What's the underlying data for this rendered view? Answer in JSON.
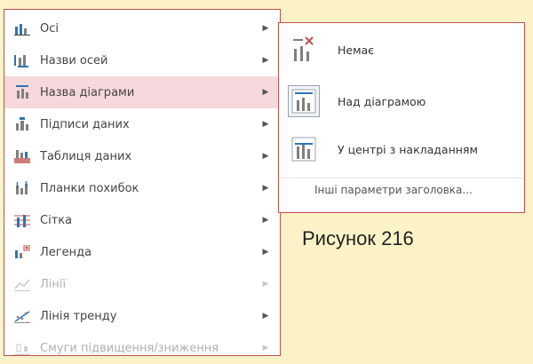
{
  "main_menu": {
    "items": [
      {
        "label": "Осі",
        "icon": "axes-icon",
        "disabled": false,
        "highlighted": false
      },
      {
        "label": "Назви осей",
        "icon": "axis-titles-icon",
        "disabled": false,
        "highlighted": false
      },
      {
        "label": "Назва діаграми",
        "icon": "chart-title-icon",
        "disabled": false,
        "highlighted": true
      },
      {
        "label": "Підписи даних",
        "icon": "data-labels-icon",
        "disabled": false,
        "highlighted": false
      },
      {
        "label": "Таблиця даних",
        "icon": "data-table-icon",
        "disabled": false,
        "highlighted": false
      },
      {
        "label": "Планки похибок",
        "icon": "error-bars-icon",
        "disabled": false,
        "highlighted": false
      },
      {
        "label": "Сітка",
        "icon": "gridlines-icon",
        "disabled": false,
        "highlighted": false
      },
      {
        "label": "Легенда",
        "icon": "legend-icon",
        "disabled": false,
        "highlighted": false
      },
      {
        "label": "Лінії",
        "icon": "lines-icon",
        "disabled": true,
        "highlighted": false
      },
      {
        "label": "Лінія тренду",
        "icon": "trendline-icon",
        "disabled": false,
        "highlighted": false
      },
      {
        "label": "Смуги підвищення/зниження",
        "icon": "up-down-bars-icon",
        "disabled": true,
        "highlighted": false
      }
    ]
  },
  "sub_menu": {
    "items": [
      {
        "label": "Немає",
        "icon": "no-title-icon",
        "selected": false
      },
      {
        "label": "Над діаграмою",
        "icon": "above-chart-icon",
        "selected": true
      },
      {
        "label": "У центрі з накладанням",
        "icon": "centered-overlay-icon",
        "selected": false
      }
    ],
    "more_options": "Інші параметри заголовка..."
  },
  "caption": "Рисунок 216",
  "colors": {
    "background": "#fbf3c7",
    "border": "#c0504d",
    "highlight": "#f7d8dc",
    "accent": "#2e75b6"
  }
}
